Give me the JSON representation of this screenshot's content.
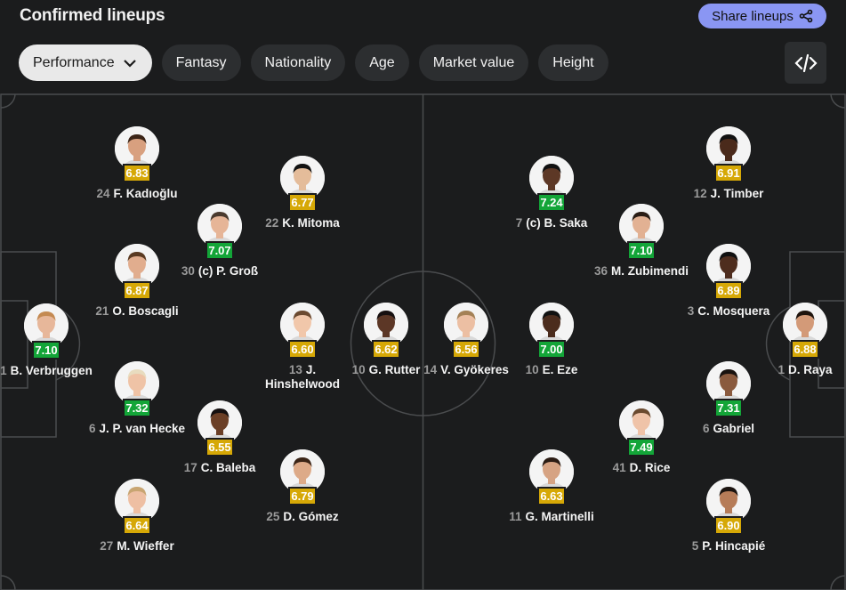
{
  "header": {
    "title": "Confirmed lineups",
    "share_label": "Share lineups",
    "share_color": "#8a96f3"
  },
  "tabs": [
    {
      "label": "Performance",
      "active": true
    },
    {
      "label": "Fantasy"
    },
    {
      "label": "Nationality"
    },
    {
      "label": "Age"
    },
    {
      "label": "Market value"
    },
    {
      "label": "Height"
    }
  ],
  "rating_colors": {
    "green": "#13a538",
    "yellow": "#d6a806"
  },
  "home": [
    {
      "num": "1",
      "name": "B. Verbruggen",
      "rating": "7.10",
      "color": "green",
      "skin": "#e7b79a",
      "hair": "#c48a52"
    },
    {
      "num": "24",
      "name": "F. Kadıoğlu",
      "rating": "6.83",
      "color": "yellow",
      "skin": "#d8a07f",
      "hair": "#3b2417"
    },
    {
      "num": "21",
      "name": "O. Boscagli",
      "rating": "6.87",
      "color": "yellow",
      "skin": "#e1ad8e",
      "hair": "#5a3a22"
    },
    {
      "num": "6",
      "name": "J. P. van Hecke",
      "rating": "7.32",
      "color": "green",
      "skin": "#efc3a6",
      "hair": "#e8dcbf"
    },
    {
      "num": "27",
      "name": "M. Wieffer",
      "rating": "6.64",
      "color": "yellow",
      "skin": "#eebfa3",
      "hair": "#c8a572"
    },
    {
      "num": "30",
      "name": "(c) P. Groß",
      "rating": "7.07",
      "color": "green",
      "skin": "#e6b597",
      "hair": "#4a3a2e"
    },
    {
      "num": "17",
      "name": "C. Baleba",
      "rating": "6.55",
      "color": "yellow",
      "skin": "#6b3f26",
      "hair": "#151010"
    },
    {
      "num": "22",
      "name": "K. Mitoma",
      "rating": "6.77",
      "color": "yellow",
      "skin": "#e4bc9a",
      "hair": "#121212"
    },
    {
      "num": "13",
      "name": "J. Hinshelwood",
      "rating": "6.60",
      "color": "yellow",
      "skin": "#f1c7aa",
      "hair": "#6b4a30"
    },
    {
      "num": "25",
      "name": "D. Gómez",
      "rating": "6.79",
      "color": "yellow",
      "skin": "#ddaa88",
      "hair": "#3a2416"
    },
    {
      "num": "10",
      "name": "G. Rutter",
      "rating": "6.62",
      "color": "yellow",
      "skin": "#5c3726",
      "hair": "#161010"
    }
  ],
  "away": [
    {
      "num": "14",
      "name": "V. Gyökeres",
      "rating": "6.56",
      "color": "yellow",
      "skin": "#ecbfa3",
      "hair": "#a48156"
    },
    {
      "num": "7",
      "name": "(c) B. Saka",
      "rating": "7.24",
      "color": "green",
      "skin": "#5d3826",
      "hair": "#111"
    },
    {
      "num": "10",
      "name": "E. Eze",
      "rating": "7.00",
      "color": "green",
      "skin": "#4b2c1d",
      "hair": "#111"
    },
    {
      "num": "11",
      "name": "G. Martinelli",
      "rating": "6.63",
      "color": "yellow",
      "skin": "#d6a383",
      "hair": "#2b1c14"
    },
    {
      "num": "36",
      "name": "M. Zubimendi",
      "rating": "7.10",
      "color": "green",
      "skin": "#e2b193",
      "hair": "#2a1d15"
    },
    {
      "num": "41",
      "name": "D. Rice",
      "rating": "7.49",
      "color": "green",
      "skin": "#efc3a8",
      "hair": "#6a4a2f"
    },
    {
      "num": "12",
      "name": "J. Timber",
      "rating": "6.91",
      "color": "yellow",
      "skin": "#4a2a1b",
      "hair": "#111"
    },
    {
      "num": "3",
      "name": "C. Mosquera",
      "rating": "6.89",
      "color": "yellow",
      "skin": "#4e2d1e",
      "hair": "#111"
    },
    {
      "num": "6",
      "name": "Gabriel",
      "rating": "7.31",
      "color": "green",
      "skin": "#8a5a3e",
      "hair": "#1a1310"
    },
    {
      "num": "5",
      "name": "P. Hincapié",
      "rating": "6.90",
      "color": "yellow",
      "skin": "#b67c58",
      "hair": "#1b1410"
    },
    {
      "num": "1",
      "name": "D. Raya",
      "rating": "6.88",
      "color": "yellow",
      "skin": "#d39a78",
      "hair": "#1e140e"
    }
  ]
}
